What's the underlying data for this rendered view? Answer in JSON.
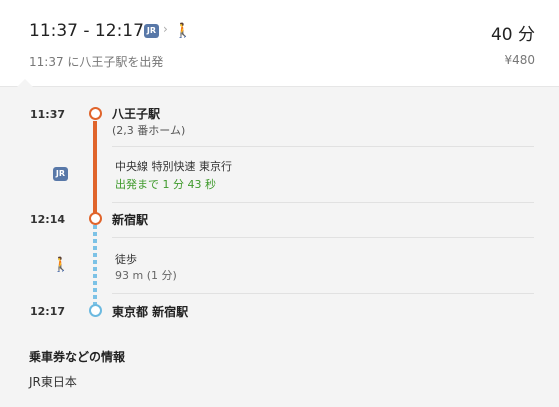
{
  "header": {
    "time_range": "11:37 - 12:17",
    "jr_badge": "JR",
    "walk_icon": "walking-person-icon",
    "duration": "40 分",
    "depart_text": "11:37 に八王子駅を出発",
    "fare": "¥480"
  },
  "itinerary": {
    "stop1": {
      "time": "11:37",
      "name": "八王子駅",
      "platform": "(2,3 番ホーム)"
    },
    "train": {
      "badge": "JR",
      "line": "中央線 特別快速 東京行",
      "countdown": "出発まで 1 分 43 秒"
    },
    "stop2": {
      "time": "12:14",
      "name": "新宿駅"
    },
    "walk": {
      "label": "徒歩",
      "detail": "93 m (1 分)",
      "icon": "walking-person-icon"
    },
    "stop3": {
      "time": "12:17",
      "name": "東京都 新宿駅"
    }
  },
  "ticket_info": {
    "heading": "乗車券などの情報",
    "operator": "JR東日本"
  },
  "colors": {
    "train_line": "#e0642b",
    "walk_line": "#7cc2e6",
    "jr_badge": "#5878a8",
    "countdown": "#3f9a2c"
  }
}
